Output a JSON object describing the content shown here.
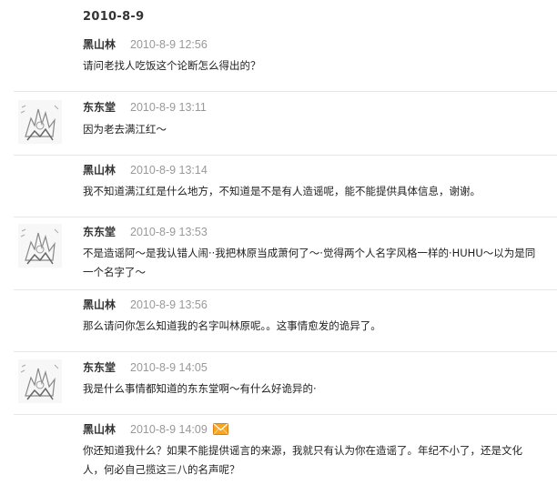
{
  "date_header": "2010-8-9",
  "comments": [
    {
      "author": "黑山林",
      "time": "2010-8-9 12:56",
      "has_avatar": false,
      "text": "请问老找人吃饭这个论断怎么得出的？"
    },
    {
      "author": "东东堂",
      "time": "2010-8-9 13:11",
      "has_avatar": true,
      "text": "因为老去满江红～"
    },
    {
      "author": "黑山林",
      "time": "2010-8-9 13:14",
      "has_avatar": false,
      "text": "我不知道满江红是什么地方，不知道是不是有人造谣呢，能不能提供具体信息，谢谢。"
    },
    {
      "author": "东东堂",
      "time": "2010-8-9 13:53",
      "has_avatar": true,
      "text_lines": [
        "不是造谣阿～是我认错人闹··我把林原当成萧何了～·觉得两个人名字风格一样的·HUHU～以为是同",
        "一个名字了～"
      ]
    },
    {
      "author": "黑山林",
      "time": "2010-8-9 13:56",
      "has_avatar": false,
      "text": "那么请问你怎么知道我的名字叫林原呢。。这事情愈发的诡异了。"
    },
    {
      "author": "东东堂",
      "time": "2010-8-9 14:05",
      "has_avatar": true,
      "text": "我是什么事情都知道的东东堂啊～有什么好诡异的·"
    },
    {
      "author": "黑山林",
      "time": "2010-8-9 14:09",
      "has_avatar": false,
      "has_mail_icon": true,
      "icon": "mail-icon",
      "text_lines": [
        "你还知道我什么？如果不能提供谣言的来源，我就只有认为你在造谣了。年纪不小了，还是文化",
        "人，何必自己揽这三八的名声呢？"
      ]
    }
  ],
  "colors": {
    "author": "#333333",
    "time": "#999999",
    "divider": "#e6e6e6",
    "mail_icon": "#f0a030"
  }
}
